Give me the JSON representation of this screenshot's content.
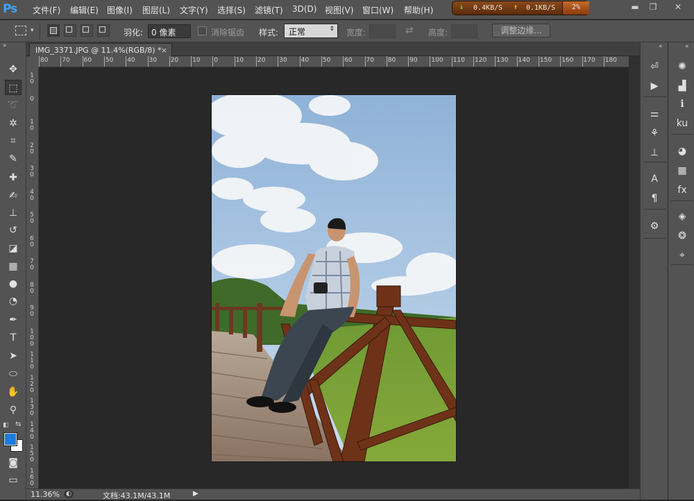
{
  "app": {
    "logo": "Ps"
  },
  "menu": [
    "文件(F)",
    "编辑(E)",
    "图像(I)",
    "图层(L)",
    "文字(Y)",
    "选择(S)",
    "滤镜(T)",
    "3D(D)",
    "视图(V)",
    "窗口(W)",
    "帮助(H)"
  ],
  "net_widget": {
    "down_icon": "↓",
    "down": "0.4KB/S",
    "up_icon": "↑",
    "up": "0.1KB/S",
    "percent": "2%"
  },
  "window_controls": {
    "minimize": "▬",
    "restore": "❐",
    "close": "✕"
  },
  "options": {
    "feather_label": "羽化:",
    "feather_value": "0 像素",
    "antialias_label": "消除锯齿",
    "style_label": "样式:",
    "style_value": "正常",
    "width_label": "宽度:",
    "height_label": "高度:",
    "refine_edge": "调整边缘..."
  },
  "document": {
    "tab_title": "IMG_3371.JPG @ 11.4%(RGB/8) *",
    "tab_close": "×"
  },
  "ruler": {
    "h_ticks": [
      "80",
      "70",
      "60",
      "50",
      "40",
      "30",
      "20",
      "10",
      "0",
      "10",
      "20",
      "30",
      "40",
      "50",
      "60",
      "70",
      "80",
      "90",
      "100",
      "110",
      "120",
      "130",
      "140",
      "150",
      "160",
      "170",
      "180"
    ],
    "v_ticks": [
      "10",
      "0",
      "10",
      "20",
      "30",
      "40",
      "50",
      "60",
      "70",
      "80",
      "90",
      "100",
      "110",
      "120",
      "130",
      "140",
      "150",
      "160"
    ]
  },
  "status": {
    "zoom": "11.36%",
    "doc_label": "文档:43.1M/43.1M",
    "arrow": "▶"
  },
  "panel_collapse": {
    "left": "»",
    "right_a": "«",
    "right_b": "«"
  },
  "tools": [
    {
      "name": "move-tool",
      "glyph": "✥"
    },
    {
      "name": "marquee-tool",
      "glyph": "⬚"
    },
    {
      "name": "lasso-tool",
      "glyph": "➰"
    },
    {
      "name": "magic-wand-tool",
      "glyph": "✲"
    },
    {
      "name": "crop-tool",
      "glyph": "⌗"
    },
    {
      "name": "eyedropper-tool",
      "glyph": "✎"
    },
    {
      "name": "healing-brush-tool",
      "glyph": "✚"
    },
    {
      "name": "brush-tool",
      "glyph": "✍"
    },
    {
      "name": "clone-stamp-tool",
      "glyph": "⊥"
    },
    {
      "name": "history-brush-tool",
      "glyph": "↺"
    },
    {
      "name": "eraser-tool",
      "glyph": "◪"
    },
    {
      "name": "gradient-tool",
      "glyph": "▦"
    },
    {
      "name": "blur-tool",
      "glyph": "●"
    },
    {
      "name": "dodge-tool",
      "glyph": "◔"
    },
    {
      "name": "pen-tool",
      "glyph": "✒"
    },
    {
      "name": "type-tool",
      "glyph": "T"
    },
    {
      "name": "path-selection-tool",
      "glyph": "➤"
    },
    {
      "name": "ellipse-tool",
      "glyph": "⬭"
    },
    {
      "name": "hand-tool",
      "glyph": "✋"
    },
    {
      "name": "zoom-tool",
      "glyph": "⚲"
    }
  ],
  "colors": {
    "foreground": "#1e7be0",
    "background": "#ffffff",
    "ui_dark": "#282828",
    "ui_panel": "#535353"
  },
  "right_panel_a": [
    {
      "name": "history-panel-icon",
      "glyph": "⏎"
    },
    {
      "name": "actions-panel-icon",
      "glyph": "▶"
    },
    {
      "name": "adjustments-panel-icon",
      "glyph": "⚌"
    },
    {
      "name": "brush-presets-panel-icon",
      "glyph": "⚘"
    },
    {
      "name": "clone-source-panel-icon",
      "glyph": "⊥"
    },
    {
      "name": "character-panel-icon",
      "glyph": "A"
    },
    {
      "name": "paragraph-panel-icon",
      "glyph": "¶"
    },
    {
      "name": "tool-presets-panel-icon",
      "glyph": "⚙"
    }
  ],
  "right_panel_b": [
    {
      "name": "navigator-panel-icon",
      "glyph": "✺"
    },
    {
      "name": "histogram-panel-icon",
      "glyph": "▟"
    },
    {
      "name": "info-panel-icon",
      "glyph": "ℹ"
    },
    {
      "name": "kuler-panel-icon",
      "glyph": "ku"
    },
    {
      "name": "color-panel-icon",
      "glyph": "◕"
    },
    {
      "name": "swatches-panel-icon",
      "glyph": "▦"
    },
    {
      "name": "styles-panel-icon",
      "glyph": "fx"
    },
    {
      "name": "layers-panel-icon",
      "glyph": "◈"
    },
    {
      "name": "channels-panel-icon",
      "glyph": "❂"
    },
    {
      "name": "paths-panel-icon",
      "glyph": "⌖"
    }
  ]
}
